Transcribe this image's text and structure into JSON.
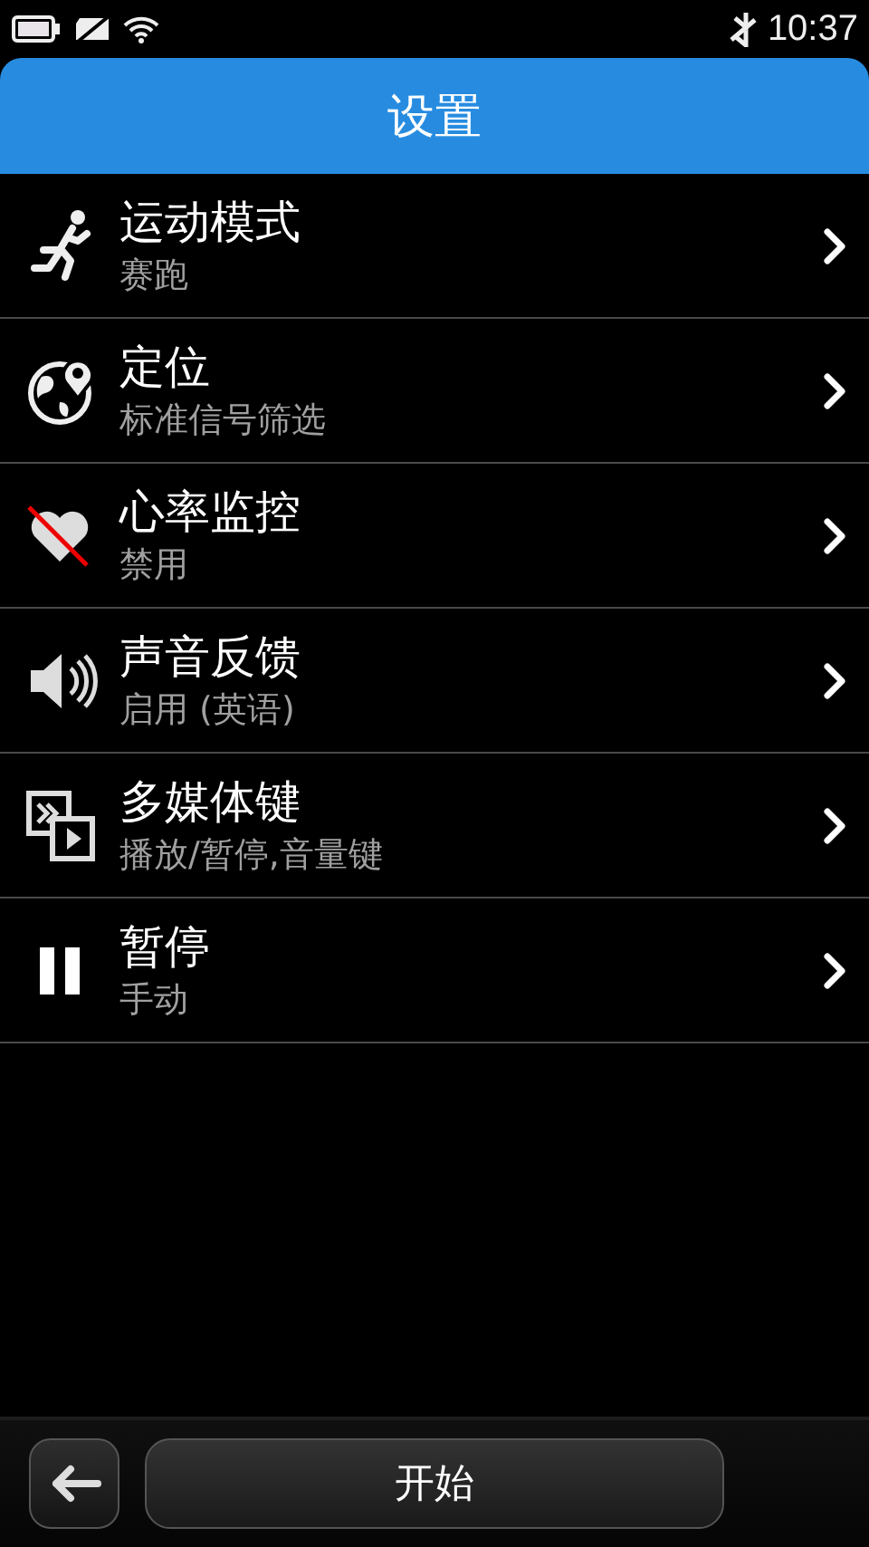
{
  "status_bar": {
    "time": "10:37"
  },
  "header": {
    "title": "设置"
  },
  "items": [
    {
      "kind": "sport",
      "title": "运动模式",
      "subtitle": "赛跑"
    },
    {
      "kind": "location",
      "title": "定位",
      "subtitle": "标准信号筛选"
    },
    {
      "kind": "heart",
      "title": "心率监控",
      "subtitle": "禁用"
    },
    {
      "kind": "sound",
      "title": "声音反馈",
      "subtitle": "启用 (英语)"
    },
    {
      "kind": "media",
      "title": "多媒体键",
      "subtitle": "播放/暂停,音量键"
    },
    {
      "kind": "pause",
      "title": "暂停",
      "subtitle": "手动"
    }
  ],
  "toolbar": {
    "start_label": "开始"
  }
}
